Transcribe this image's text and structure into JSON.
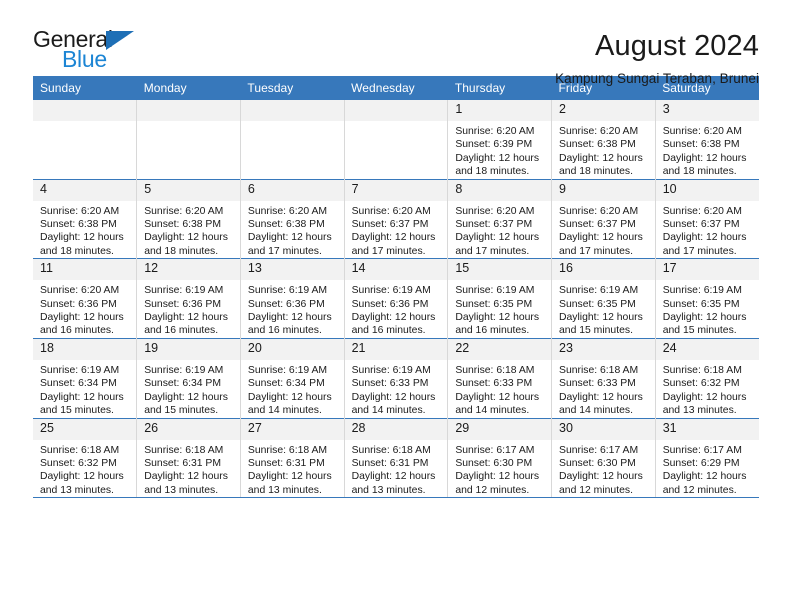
{
  "brand": {
    "name_top": "General",
    "name_bottom": "Blue",
    "triangle_color": "#1e6fb6",
    "blue_color": "#1c85d4"
  },
  "header": {
    "month_title": "August 2024",
    "location": "Kampung Sungai Teraban, Brunei"
  },
  "theme": {
    "header_blue": "#3778bb",
    "daynum_bg": "#f2f2f2",
    "cell_border": "#d8d8d8"
  },
  "calendar": {
    "weekday_headers": [
      "Sunday",
      "Monday",
      "Tuesday",
      "Wednesday",
      "Thursday",
      "Friday",
      "Saturday"
    ],
    "weeks": [
      [
        {
          "day": "",
          "empty": true
        },
        {
          "day": "",
          "empty": true
        },
        {
          "day": "",
          "empty": true
        },
        {
          "day": "",
          "empty": true
        },
        {
          "day": "1",
          "sunrise": "Sunrise: 6:20 AM",
          "sunset": "Sunset: 6:39 PM",
          "daylight1": "Daylight: 12 hours",
          "daylight2": "and 18 minutes."
        },
        {
          "day": "2",
          "sunrise": "Sunrise: 6:20 AM",
          "sunset": "Sunset: 6:38 PM",
          "daylight1": "Daylight: 12 hours",
          "daylight2": "and 18 minutes."
        },
        {
          "day": "3",
          "sunrise": "Sunrise: 6:20 AM",
          "sunset": "Sunset: 6:38 PM",
          "daylight1": "Daylight: 12 hours",
          "daylight2": "and 18 minutes."
        }
      ],
      [
        {
          "day": "4",
          "sunrise": "Sunrise: 6:20 AM",
          "sunset": "Sunset: 6:38 PM",
          "daylight1": "Daylight: 12 hours",
          "daylight2": "and 18 minutes."
        },
        {
          "day": "5",
          "sunrise": "Sunrise: 6:20 AM",
          "sunset": "Sunset: 6:38 PM",
          "daylight1": "Daylight: 12 hours",
          "daylight2": "and 18 minutes."
        },
        {
          "day": "6",
          "sunrise": "Sunrise: 6:20 AM",
          "sunset": "Sunset: 6:38 PM",
          "daylight1": "Daylight: 12 hours",
          "daylight2": "and 17 minutes."
        },
        {
          "day": "7",
          "sunrise": "Sunrise: 6:20 AM",
          "sunset": "Sunset: 6:37 PM",
          "daylight1": "Daylight: 12 hours",
          "daylight2": "and 17 minutes."
        },
        {
          "day": "8",
          "sunrise": "Sunrise: 6:20 AM",
          "sunset": "Sunset: 6:37 PM",
          "daylight1": "Daylight: 12 hours",
          "daylight2": "and 17 minutes."
        },
        {
          "day": "9",
          "sunrise": "Sunrise: 6:20 AM",
          "sunset": "Sunset: 6:37 PM",
          "daylight1": "Daylight: 12 hours",
          "daylight2": "and 17 minutes."
        },
        {
          "day": "10",
          "sunrise": "Sunrise: 6:20 AM",
          "sunset": "Sunset: 6:37 PM",
          "daylight1": "Daylight: 12 hours",
          "daylight2": "and 17 minutes."
        }
      ],
      [
        {
          "day": "11",
          "sunrise": "Sunrise: 6:20 AM",
          "sunset": "Sunset: 6:36 PM",
          "daylight1": "Daylight: 12 hours",
          "daylight2": "and 16 minutes."
        },
        {
          "day": "12",
          "sunrise": "Sunrise: 6:19 AM",
          "sunset": "Sunset: 6:36 PM",
          "daylight1": "Daylight: 12 hours",
          "daylight2": "and 16 minutes."
        },
        {
          "day": "13",
          "sunrise": "Sunrise: 6:19 AM",
          "sunset": "Sunset: 6:36 PM",
          "daylight1": "Daylight: 12 hours",
          "daylight2": "and 16 minutes."
        },
        {
          "day": "14",
          "sunrise": "Sunrise: 6:19 AM",
          "sunset": "Sunset: 6:36 PM",
          "daylight1": "Daylight: 12 hours",
          "daylight2": "and 16 minutes."
        },
        {
          "day": "15",
          "sunrise": "Sunrise: 6:19 AM",
          "sunset": "Sunset: 6:35 PM",
          "daylight1": "Daylight: 12 hours",
          "daylight2": "and 16 minutes."
        },
        {
          "day": "16",
          "sunrise": "Sunrise: 6:19 AM",
          "sunset": "Sunset: 6:35 PM",
          "daylight1": "Daylight: 12 hours",
          "daylight2": "and 15 minutes."
        },
        {
          "day": "17",
          "sunrise": "Sunrise: 6:19 AM",
          "sunset": "Sunset: 6:35 PM",
          "daylight1": "Daylight: 12 hours",
          "daylight2": "and 15 minutes."
        }
      ],
      [
        {
          "day": "18",
          "sunrise": "Sunrise: 6:19 AM",
          "sunset": "Sunset: 6:34 PM",
          "daylight1": "Daylight: 12 hours",
          "daylight2": "and 15 minutes."
        },
        {
          "day": "19",
          "sunrise": "Sunrise: 6:19 AM",
          "sunset": "Sunset: 6:34 PM",
          "daylight1": "Daylight: 12 hours",
          "daylight2": "and 15 minutes."
        },
        {
          "day": "20",
          "sunrise": "Sunrise: 6:19 AM",
          "sunset": "Sunset: 6:34 PM",
          "daylight1": "Daylight: 12 hours",
          "daylight2": "and 14 minutes."
        },
        {
          "day": "21",
          "sunrise": "Sunrise: 6:19 AM",
          "sunset": "Sunset: 6:33 PM",
          "daylight1": "Daylight: 12 hours",
          "daylight2": "and 14 minutes."
        },
        {
          "day": "22",
          "sunrise": "Sunrise: 6:18 AM",
          "sunset": "Sunset: 6:33 PM",
          "daylight1": "Daylight: 12 hours",
          "daylight2": "and 14 minutes."
        },
        {
          "day": "23",
          "sunrise": "Sunrise: 6:18 AM",
          "sunset": "Sunset: 6:33 PM",
          "daylight1": "Daylight: 12 hours",
          "daylight2": "and 14 minutes."
        },
        {
          "day": "24",
          "sunrise": "Sunrise: 6:18 AM",
          "sunset": "Sunset: 6:32 PM",
          "daylight1": "Daylight: 12 hours",
          "daylight2": "and 13 minutes."
        }
      ],
      [
        {
          "day": "25",
          "sunrise": "Sunrise: 6:18 AM",
          "sunset": "Sunset: 6:32 PM",
          "daylight1": "Daylight: 12 hours",
          "daylight2": "and 13 minutes."
        },
        {
          "day": "26",
          "sunrise": "Sunrise: 6:18 AM",
          "sunset": "Sunset: 6:31 PM",
          "daylight1": "Daylight: 12 hours",
          "daylight2": "and 13 minutes."
        },
        {
          "day": "27",
          "sunrise": "Sunrise: 6:18 AM",
          "sunset": "Sunset: 6:31 PM",
          "daylight1": "Daylight: 12 hours",
          "daylight2": "and 13 minutes."
        },
        {
          "day": "28",
          "sunrise": "Sunrise: 6:18 AM",
          "sunset": "Sunset: 6:31 PM",
          "daylight1": "Daylight: 12 hours",
          "daylight2": "and 13 minutes."
        },
        {
          "day": "29",
          "sunrise": "Sunrise: 6:17 AM",
          "sunset": "Sunset: 6:30 PM",
          "daylight1": "Daylight: 12 hours",
          "daylight2": "and 12 minutes."
        },
        {
          "day": "30",
          "sunrise": "Sunrise: 6:17 AM",
          "sunset": "Sunset: 6:30 PM",
          "daylight1": "Daylight: 12 hours",
          "daylight2": "and 12 minutes."
        },
        {
          "day": "31",
          "sunrise": "Sunrise: 6:17 AM",
          "sunset": "Sunset: 6:29 PM",
          "daylight1": "Daylight: 12 hours",
          "daylight2": "and 12 minutes."
        }
      ]
    ]
  }
}
